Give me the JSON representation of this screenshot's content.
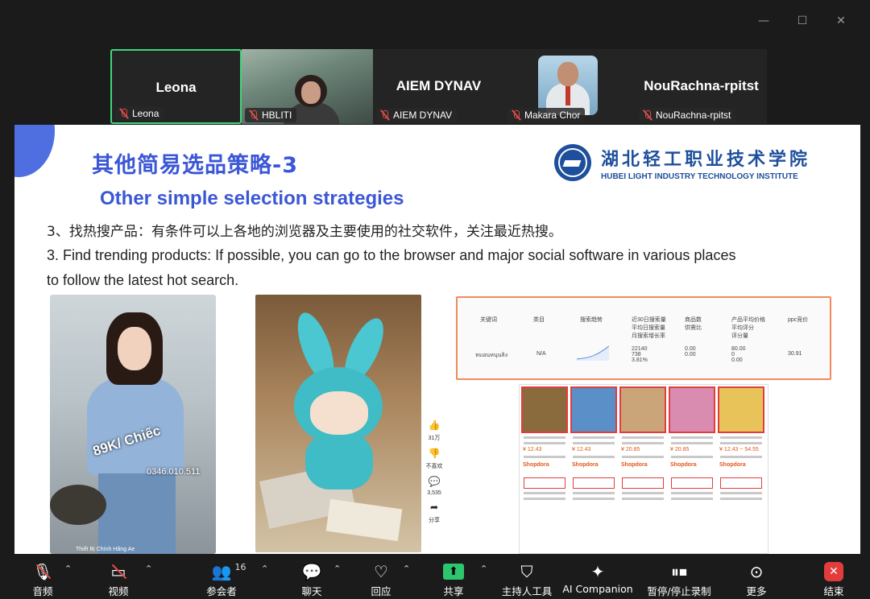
{
  "window": {
    "min": "—",
    "max": "☐",
    "close": "✕"
  },
  "participants": [
    {
      "name": "Leona",
      "display": "Leona",
      "type": "name",
      "active": true
    },
    {
      "name": "HBLITI",
      "type": "video"
    },
    {
      "name": "AIEM DYNAV",
      "display": "AIEM DYNAV",
      "type": "name"
    },
    {
      "name": "Makara Chor",
      "type": "avatar"
    },
    {
      "name": "NouRachna-rpitst",
      "display": "NouRachna-rpitst",
      "type": "name"
    }
  ],
  "slide": {
    "title_cn": "其他简易选品策略-3",
    "title_en": "Other simple selection strategies",
    "logo_cn": "湖北轻工职业技术学院",
    "logo_en": "HUBEI LIGHT INDUSTRY TECHNOLOGY INSTITUTE",
    "line_cn": "3、找热搜产品：有条件可以上各地的浏览器及主要使用的社交软件，关注最近热搜。",
    "line_en": "3. Find trending products: If possible, you can go to the browser and major social software in various places to follow the latest hot search.",
    "img1": {
      "sticker": "89K/ Chiếc",
      "phone": "0346.010.511",
      "shop": "Thiết Bị Chính Hãng Ae"
    },
    "side_actions": [
      {
        "icon": "👍",
        "count": "31万"
      },
      {
        "icon": "👎",
        "count": "不喜欢"
      },
      {
        "icon": "💬",
        "count": "3,535"
      },
      {
        "icon": "➦",
        "count": "分享"
      }
    ],
    "table": {
      "headers": [
        "关键词",
        "类目",
        "搜索趋势",
        "近30日搜索量\n平均日搜索量\n月搜索增长率",
        "商品数\n供需比",
        "产品平均价格\n平均评分\n评分量",
        "ppc竞价"
      ],
      "row": [
        "หมอนหนุนลิง",
        "N/A",
        "",
        "22140\n738\n3.81%",
        "0.00\n0.00",
        "80.00\n0\n0.00",
        "30.91"
      ]
    },
    "products": [
      {
        "price": "¥ 12.43",
        "brand": "Shopdora"
      },
      {
        "price": "¥ 12.43",
        "brand": "Shopdora"
      },
      {
        "price": "¥ 20.85",
        "brand": "Shopdora"
      },
      {
        "price": "¥ 20.85",
        "brand": "Shopdora"
      },
      {
        "price": "¥ 12.43 ~ 54.55",
        "brand": "Shopdora"
      }
    ]
  },
  "toolbar": {
    "audio": "音频",
    "video": "视频",
    "participants": "参会者",
    "participants_count": "16",
    "chat": "聊天",
    "react": "回应",
    "share": "共享",
    "host_tools": "主持人工具",
    "ai": "AI Companion",
    "record": "暂停/停止录制",
    "more": "更多",
    "end": "结束"
  }
}
